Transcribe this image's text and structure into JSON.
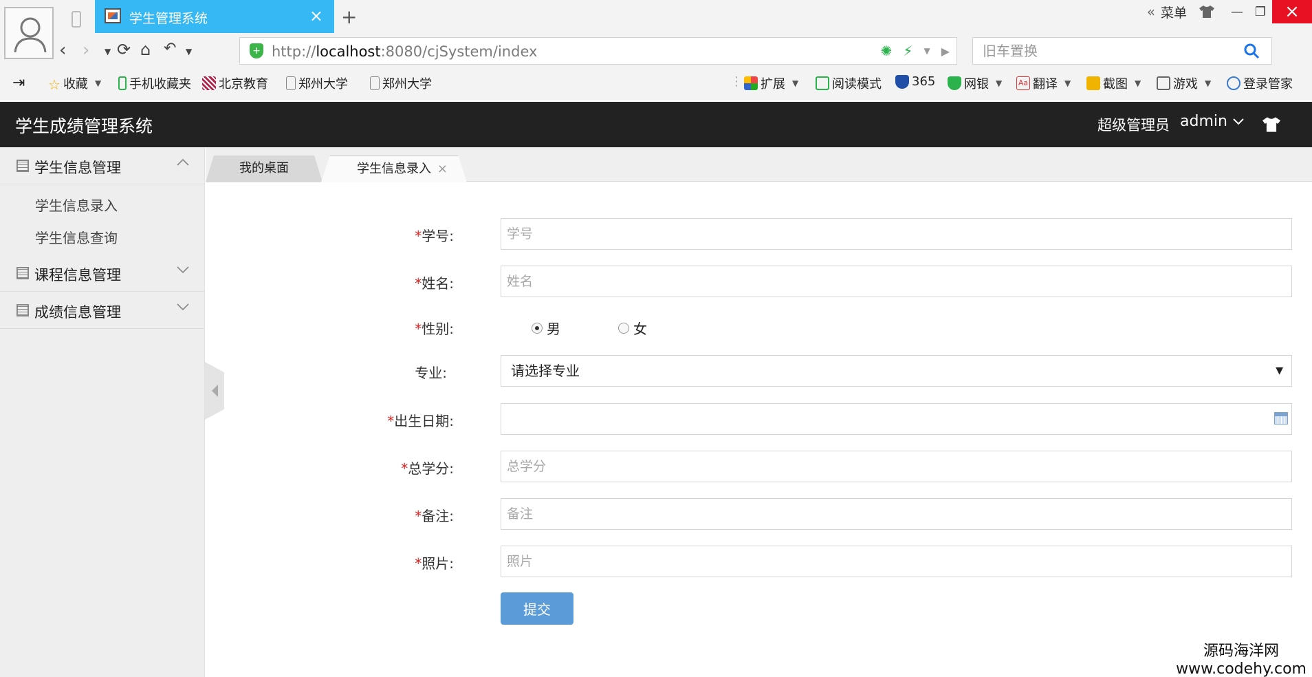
{
  "browser": {
    "tab_title": "学生管理系统",
    "tab_close": "×",
    "new_tab": "+",
    "menu_label": "菜单",
    "menu_chevron": "«",
    "url_prefix": "http://",
    "url_host": "localhost",
    "url_rest": ":8080/cjSystem/index",
    "search_placeholder": "旧车置换",
    "bookmarks": [
      {
        "label": "收藏"
      },
      {
        "label": "手机收藏夹"
      },
      {
        "label": "北京教育"
      },
      {
        "label": "郑州大学"
      },
      {
        "label": "郑州大学"
      }
    ],
    "right_tools": [
      {
        "label": "扩展"
      },
      {
        "label": "阅读模式"
      },
      {
        "label": "365"
      },
      {
        "label": "网银"
      },
      {
        "label": "翻译"
      },
      {
        "label": "截图"
      },
      {
        "label": "游戏"
      },
      {
        "label": "登录管家"
      }
    ]
  },
  "app": {
    "title": "学生成绩管理系统",
    "user_role": "超级管理员",
    "user_name": "admin"
  },
  "sidebar": {
    "groups": [
      {
        "label": "学生信息管理",
        "items": [
          "学生信息录入",
          "学生信息查询"
        ]
      },
      {
        "label": "课程信息管理"
      },
      {
        "label": "成绩信息管理"
      }
    ]
  },
  "content_tabs": {
    "home": "我的桌面",
    "current": "学生信息录入",
    "close": "×"
  },
  "form": {
    "required_mark": "*",
    "student_id": {
      "label": "学号:",
      "placeholder": "学号"
    },
    "name": {
      "label": "姓名:",
      "placeholder": "姓名"
    },
    "gender": {
      "label": "性别:",
      "options": [
        "男",
        "女"
      ],
      "selected": "男"
    },
    "major": {
      "label": "专业:",
      "selected": "请选择专业",
      "arrow": "▼"
    },
    "birth": {
      "label": "出生日期:"
    },
    "credits": {
      "label": "总学分:",
      "placeholder": "总学分"
    },
    "remark": {
      "label": "备注:",
      "placeholder": "备注"
    },
    "photo": {
      "label": "照片:",
      "placeholder": "照片"
    },
    "submit": "提交"
  },
  "watermark": {
    "line1": "源码海洋网",
    "line2": "www.codehy.com"
  }
}
